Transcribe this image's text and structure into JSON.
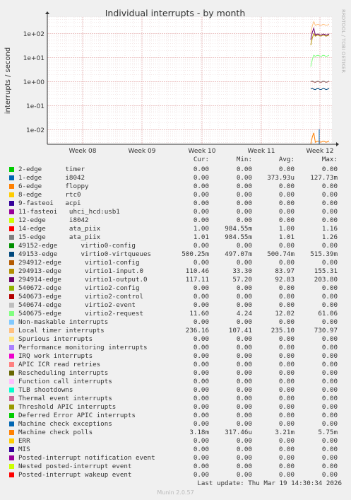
{
  "chart_data": {
    "type": "line",
    "title": "Individual interrupts - by month",
    "ylabel": "interrupts / second",
    "yscale": "log",
    "ylim": [
      0.0025,
      500
    ],
    "y_ticks": [
      "1e-02",
      "1e-01",
      "1e+00",
      "1e+01",
      "1e+02"
    ],
    "x_ticks": [
      "Week 08",
      "Week 09",
      "Week 10",
      "Week 11",
      "Week 12"
    ],
    "grid": true,
    "watermark": "RRDTOOL / TOBI OETIKER",
    "columns": [
      "Cur:",
      "Min:",
      "Avg:",
      "Max:"
    ],
    "series": [
      {
        "name": "2-edge      timer",
        "color": "#00cc00",
        "cur": "0.00",
        "min": "0.00",
        "avg": "0.00",
        "max": "0.00"
      },
      {
        "name": "1-edge      i8042",
        "color": "#0066b3",
        "cur": "0.00",
        "min": "0.00",
        "avg": "373.93u",
        "max": "127.73m"
      },
      {
        "name": "6-edge      floppy",
        "color": "#ff8000",
        "cur": "0.00",
        "min": "0.00",
        "avg": "0.00",
        "max": "0.00"
      },
      {
        "name": "8-edge      rtc0",
        "color": "#ffcc00",
        "cur": "0.00",
        "min": "0.00",
        "avg": "0.00",
        "max": "0.00"
      },
      {
        "name": "9-fasteoi   acpi",
        "color": "#330099",
        "cur": "0.00",
        "min": "0.00",
        "avg": "0.00",
        "max": "0.00"
      },
      {
        "name": "11-fasteoi   uhci_hcd:usb1",
        "color": "#990099",
        "cur": "0.00",
        "min": "0.00",
        "avg": "0.00",
        "max": "0.00"
      },
      {
        "name": "12-edge      i8042",
        "color": "#ccff00",
        "cur": "0.00",
        "min": "0.00",
        "avg": "0.00",
        "max": "0.00"
      },
      {
        "name": "14-edge      ata_piix",
        "color": "#ff0000",
        "cur": "1.00",
        "min": "984.55m",
        "avg": "1.00",
        "max": "1.16"
      },
      {
        "name": "15-edge      ata_piix",
        "color": "#808080",
        "cur": "1.01",
        "min": "984.55m",
        "avg": "1.01",
        "max": "1.26"
      },
      {
        "name": "49152-edge      virtio0-config",
        "color": "#008f00",
        "cur": "0.00",
        "min": "0.00",
        "avg": "0.00",
        "max": "0.00"
      },
      {
        "name": "49153-edge      virtio0-virtqueues",
        "color": "#00487d",
        "cur": "500.25m",
        "min": "497.07m",
        "avg": "500.74m",
        "max": "515.39m"
      },
      {
        "name": "294912-edge      virtio1-config",
        "color": "#b35a00",
        "cur": "0.00",
        "min": "0.00",
        "avg": "0.00",
        "max": "0.00"
      },
      {
        "name": "294913-edge      virtio1-input.0",
        "color": "#b38f00",
        "cur": "110.46",
        "min": "33.30",
        "avg": "83.97",
        "max": "155.31"
      },
      {
        "name": "294914-edge      virtio1-output.0",
        "color": "#6b006b",
        "cur": "117.11",
        "min": "57.20",
        "avg": "92.83",
        "max": "203.80"
      },
      {
        "name": "540672-edge      virtio2-config",
        "color": "#8fb300",
        "cur": "0.00",
        "min": "0.00",
        "avg": "0.00",
        "max": "0.00"
      },
      {
        "name": "540673-edge      virtio2-control",
        "color": "#b30000",
        "cur": "0.00",
        "min": "0.00",
        "avg": "0.00",
        "max": "0.00"
      },
      {
        "name": "540674-edge      virtio2-event",
        "color": "#bebebe",
        "cur": "0.00",
        "min": "0.00",
        "avg": "0.00",
        "max": "0.00"
      },
      {
        "name": "540675-edge      virtio2-request",
        "color": "#80ff80",
        "cur": "11.60",
        "min": "4.24",
        "avg": "12.02",
        "max": "61.06"
      },
      {
        "name": "Non-maskable interrupts",
        "color": "#80c9ff",
        "cur": "0.00",
        "min": "0.00",
        "avg": "0.00",
        "max": "0.00"
      },
      {
        "name": "Local timer interrupts",
        "color": "#ffc080",
        "cur": "236.16",
        "min": "107.41",
        "avg": "235.10",
        "max": "730.97"
      },
      {
        "name": "Spurious interrupts",
        "color": "#ffe680",
        "cur": "0.00",
        "min": "0.00",
        "avg": "0.00",
        "max": "0.00"
      },
      {
        "name": "Performance monitoring interrupts",
        "color": "#aa80ff",
        "cur": "0.00",
        "min": "0.00",
        "avg": "0.00",
        "max": "0.00"
      },
      {
        "name": "IRQ work interrupts",
        "color": "#ee00cc",
        "cur": "0.00",
        "min": "0.00",
        "avg": "0.00",
        "max": "0.00"
      },
      {
        "name": "APIC ICR read retries",
        "color": "#ff8080",
        "cur": "0.00",
        "min": "0.00",
        "avg": "0.00",
        "max": "0.00"
      },
      {
        "name": "Rescheduling interrupts",
        "color": "#666600",
        "cur": "0.00",
        "min": "0.00",
        "avg": "0.00",
        "max": "0.00"
      },
      {
        "name": "Function call interrupts",
        "color": "#ffbfff",
        "cur": "0.00",
        "min": "0.00",
        "avg": "0.00",
        "max": "0.00"
      },
      {
        "name": "TLB shootdowns",
        "color": "#00ffcc",
        "cur": "0.00",
        "min": "0.00",
        "avg": "0.00",
        "max": "0.00"
      },
      {
        "name": "Thermal event interrupts",
        "color": "#cc6699",
        "cur": "0.00",
        "min": "0.00",
        "avg": "0.00",
        "max": "0.00"
      },
      {
        "name": "Threshold APIC interrupts",
        "color": "#999900",
        "cur": "0.00",
        "min": "0.00",
        "avg": "0.00",
        "max": "0.00"
      },
      {
        "name": "Deferred Error APIC interrupts",
        "color": "#00cc00",
        "cur": "0.00",
        "min": "0.00",
        "avg": "0.00",
        "max": "0.00"
      },
      {
        "name": "Machine check exceptions",
        "color": "#0066b3",
        "cur": "0.00",
        "min": "0.00",
        "avg": "0.00",
        "max": "0.00"
      },
      {
        "name": "Machine check polls",
        "color": "#ff8000",
        "cur": "3.18m",
        "min": "317.46u",
        "avg": "3.21m",
        "max": "5.75m"
      },
      {
        "name": "ERR",
        "color": "#ffcc00",
        "cur": "0.00",
        "min": "0.00",
        "avg": "0.00",
        "max": "0.00"
      },
      {
        "name": "MIS",
        "color": "#330099",
        "cur": "0.00",
        "min": "0.00",
        "avg": "0.00",
        "max": "0.00"
      },
      {
        "name": "Posted-interrupt notification event",
        "color": "#990099",
        "cur": "0.00",
        "min": "0.00",
        "avg": "0.00",
        "max": "0.00"
      },
      {
        "name": "Nested posted-interrupt event",
        "color": "#ccff00",
        "cur": "0.00",
        "min": "0.00",
        "avg": "0.00",
        "max": "0.00"
      },
      {
        "name": "Posted-interrupt wakeup event",
        "color": "#ff0000",
        "cur": "0.00",
        "min": "0.00",
        "avg": "0.00",
        "max": "0.00"
      }
    ],
    "last_update": "Last update: Thu Mar 19 14:30:34 2026",
    "footer": "Munin 2.0.57"
  }
}
